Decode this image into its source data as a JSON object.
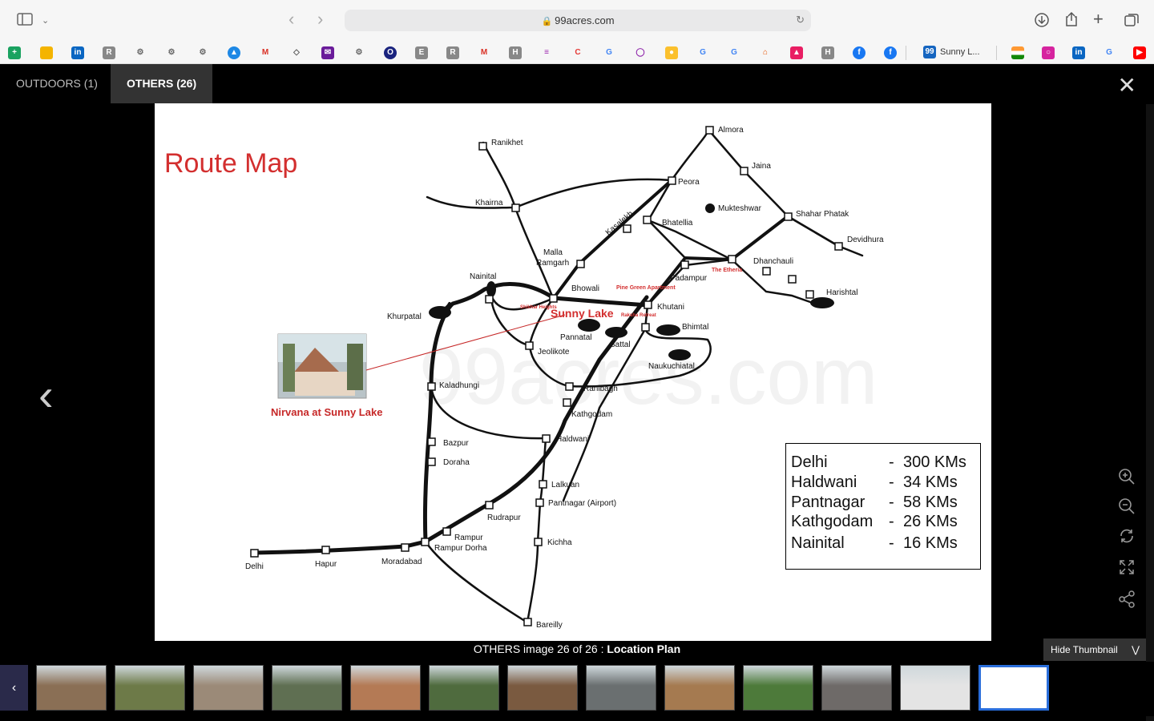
{
  "browser": {
    "url": "99acres.com",
    "bookmark_tab_label": "Sunny L...",
    "bookmark_tab_icon_text": "99"
  },
  "gallery": {
    "tabs": [
      {
        "label": "OUTDOORS (1)"
      },
      {
        "label": "OTHERS (26)"
      }
    ],
    "caption_prefix": "OTHERS image 26 of 26 : ",
    "caption_title": "Location Plan",
    "hide_thumbnail": "Hide Thumbnail"
  },
  "route_map": {
    "title": "Route Map",
    "property_name": "Nirvana at Sunny Lake",
    "highlight": "Sunny Lake",
    "watermark": "99acres.com",
    "red_labels": {
      "pine_green": "Pine Green Apartment",
      "the_etheria": "The Etheria",
      "shikhar": "Shikhar Heights",
      "raksha": "Raksha Retreat"
    },
    "places": {
      "almora": "Almora",
      "ranikhet": "Ranikhet",
      "jaina": "Jaina",
      "peora": "Peora",
      "khairna": "Khairna",
      "mukteshwar": "Mukteshwar",
      "shahar_phatak": "Shahar Phatak",
      "kasalekh": "Kasalekh",
      "bhatellia": "Bhatellia",
      "devidhura": "Devidhura",
      "malla": "Malla",
      "ramgarh": "Ramgarh",
      "dhanchauli": "Dhanchauli",
      "nainital": "Nainital",
      "padampur": "Padampur",
      "harishtal": "Harishtal",
      "bhowali": "Bhowali",
      "khurpatal": "Khurpatal",
      "khutani": "Khutani",
      "bhimtal": "Bhimtal",
      "pannatal": "Pannatal",
      "sattal": "Sattal",
      "jeolikote": "Jeolikote",
      "naukuchiatal": "Naukuchiatal",
      "kaladhungi": "Kaladhungi",
      "ranibagh": "Ranibagh",
      "kathgodam": "Kathgodam",
      "haldwani": "Haldwani",
      "bazpur": "Bazpur",
      "doraha": "Doraha",
      "lalkuan": "Lalkuan",
      "pantnagar": "Pantnagar (Airport)",
      "rudrapur": "Rudrapur",
      "rampur": "Rampur",
      "rampur_dorha": "Rampur Dorha",
      "kichha": "Kichha",
      "delhi": "Delhi",
      "hapur": "Hapur",
      "moradabad": "Moradabad",
      "bareilly": "Bareilly"
    },
    "distances": [
      {
        "place": "Delhi",
        "km": "300 KMs"
      },
      {
        "place": "Haldwani",
        "km": "34 KMs"
      },
      {
        "place": "Pantnagar",
        "km": "58 KMs"
      },
      {
        "place": "Kathgodam",
        "km": "26 KMs"
      },
      {
        "place": "Nainital",
        "km": "16 KMs"
      }
    ]
  },
  "thumbnails": [
    {
      "color": "#8a6f55"
    },
    {
      "color": "#6d7a48"
    },
    {
      "color": "#9b8a78"
    },
    {
      "color": "#5f6f52"
    },
    {
      "color": "#b47a55"
    },
    {
      "color": "#4f6b3e"
    },
    {
      "color": "#7a5a40"
    },
    {
      "color": "#6a6f70"
    },
    {
      "color": "#a57a50"
    },
    {
      "color": "#4d7a3a"
    },
    {
      "color": "#6e6a68"
    },
    {
      "color": "#e4e4e4"
    },
    {
      "color": "#ffffff"
    }
  ]
}
